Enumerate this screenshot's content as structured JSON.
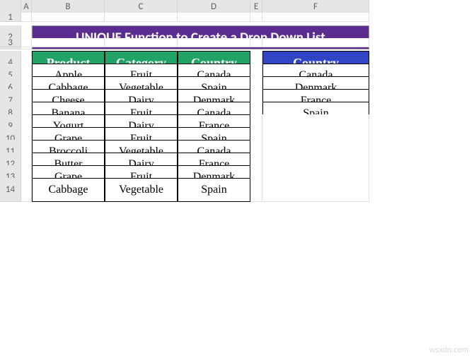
{
  "columns": [
    "A",
    "B",
    "C",
    "D",
    "E",
    "F"
  ],
  "rows": [
    "1",
    "2",
    "3",
    "4",
    "5",
    "6",
    "7",
    "8",
    "9",
    "10",
    "11",
    "12",
    "13",
    "14"
  ],
  "title": "UNIQUE Function to Create a Drop Down List",
  "mainTable": {
    "headers": [
      "Product",
      "Category",
      "Country"
    ],
    "rows": [
      [
        "Apple",
        "Fruit",
        "Canada"
      ],
      [
        "Cabbage",
        "Vegetable",
        "Spain"
      ],
      [
        "Cheese",
        "Dairy",
        "Denmark"
      ],
      [
        "Banana",
        "Fruit",
        "Canada"
      ],
      [
        "Yogurt",
        "Dairy",
        "France"
      ],
      [
        "Grape",
        "Fruit",
        "Spain"
      ],
      [
        "Broccoli",
        "Vegetable",
        "Canada"
      ],
      [
        "Butter",
        "Dairy",
        "France"
      ],
      [
        "Grape",
        "Fruit",
        "Denmark"
      ],
      [
        "Cabbage",
        "Vegetable",
        "Spain"
      ]
    ]
  },
  "sideTable": {
    "header": "Country",
    "rows": [
      "Canada",
      "Denmark",
      "France",
      "Spain"
    ]
  },
  "watermark": "wsxdn.com"
}
